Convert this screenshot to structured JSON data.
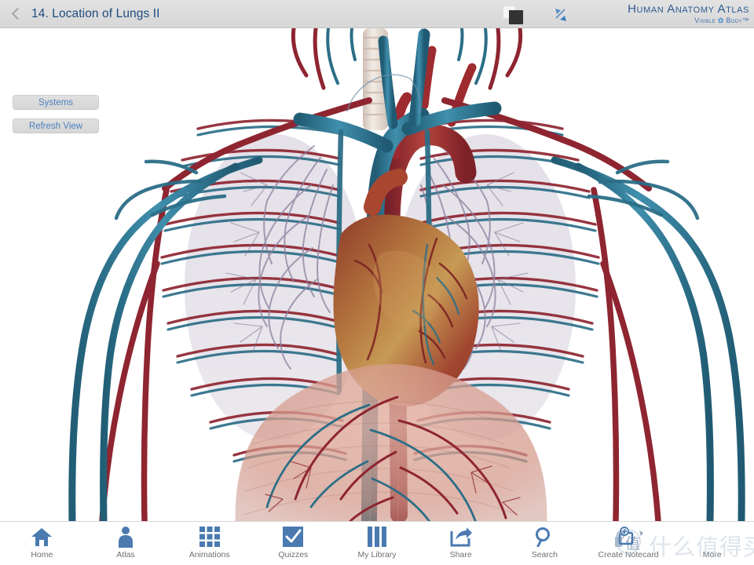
{
  "top_bar": {
    "back_label": "Back",
    "back_icon": "chevron-left-icon",
    "lesson_title": "14. Location of Lungs II",
    "layers_icon": "layers-squares-icon",
    "expand_icon": "diagonal-resize-arrows-icon",
    "brand_name": "Human Anatomy Atlas",
    "brand_sub_left": "Visible",
    "brand_sub_right": "Body",
    "brand_sub_tm": "™",
    "brand_color": "#2d5a92"
  },
  "side_controls": [
    {
      "label": "Systems",
      "name": "systems-button"
    },
    {
      "label": "Refresh View",
      "name": "refresh-view-button"
    }
  ],
  "viewer": {
    "view_title": "Thorax anterior view — heart, great vessels, ribcage vasculature, diaphragm",
    "background_color": "#ffffff",
    "structures": [
      {
        "name": "trachea",
        "color": "#e8ded5"
      },
      {
        "name": "heart",
        "color": "#a8462f"
      },
      {
        "name": "aorta",
        "color": "#9e2b2f"
      },
      {
        "name": "superior-vena-cava",
        "color": "#2c6e87"
      },
      {
        "name": "brachiocephalic-veins",
        "color": "#2c6e87"
      },
      {
        "name": "inferior-vena-cava",
        "color": "#2c6e87"
      },
      {
        "name": "subclavian-artery",
        "color": "#8e2530"
      },
      {
        "name": "intercostal-vessels",
        "color": "#8e2530"
      },
      {
        "name": "pulmonary-vasculature",
        "color": "#8d7f9e"
      },
      {
        "name": "diaphragm",
        "color": "#d9a092"
      },
      {
        "name": "arm-veins",
        "color": "#2d7a96"
      },
      {
        "name": "arm-arteries",
        "color": "#8e2530"
      }
    ],
    "palette": {
      "artery": "#8e2530",
      "artery_light": "#b04038",
      "vein": "#2c6e87",
      "vein_light": "#3e8ba6",
      "heart": "#a8462f",
      "heart_light": "#c98a4f",
      "lung_vessels": "#8d7f9e",
      "diaphragm": "#d9a092",
      "trachea": "#e8ded5"
    }
  },
  "bottom_toolbar": [
    {
      "label": "Home",
      "icon": "house-icon",
      "name": "toolbar-home"
    },
    {
      "label": "Atlas",
      "icon": "person-icon",
      "name": "toolbar-atlas"
    },
    {
      "label": "Animations",
      "icon": "grid-3x3-icon",
      "name": "toolbar-animations"
    },
    {
      "label": "Quizzes",
      "icon": "checkbox-icon",
      "name": "toolbar-quizzes"
    },
    {
      "label": "My Library",
      "icon": "books-bars-icon",
      "name": "toolbar-my-library"
    },
    {
      "label": "Share",
      "icon": "share-arrow-icon",
      "name": "toolbar-share"
    },
    {
      "label": "Search",
      "icon": "magnifier-icon",
      "name": "toolbar-search"
    },
    {
      "label": "Create Notecard",
      "icon": "notecard-icon",
      "name": "toolbar-create-notecard"
    },
    {
      "label": "More",
      "icon": "more-icon",
      "name": "toolbar-more"
    }
  ],
  "toolbar_icon_color": "#4a7ab0",
  "watermark": {
    "text": "什么值得买",
    "logo_glyph": "值"
  }
}
